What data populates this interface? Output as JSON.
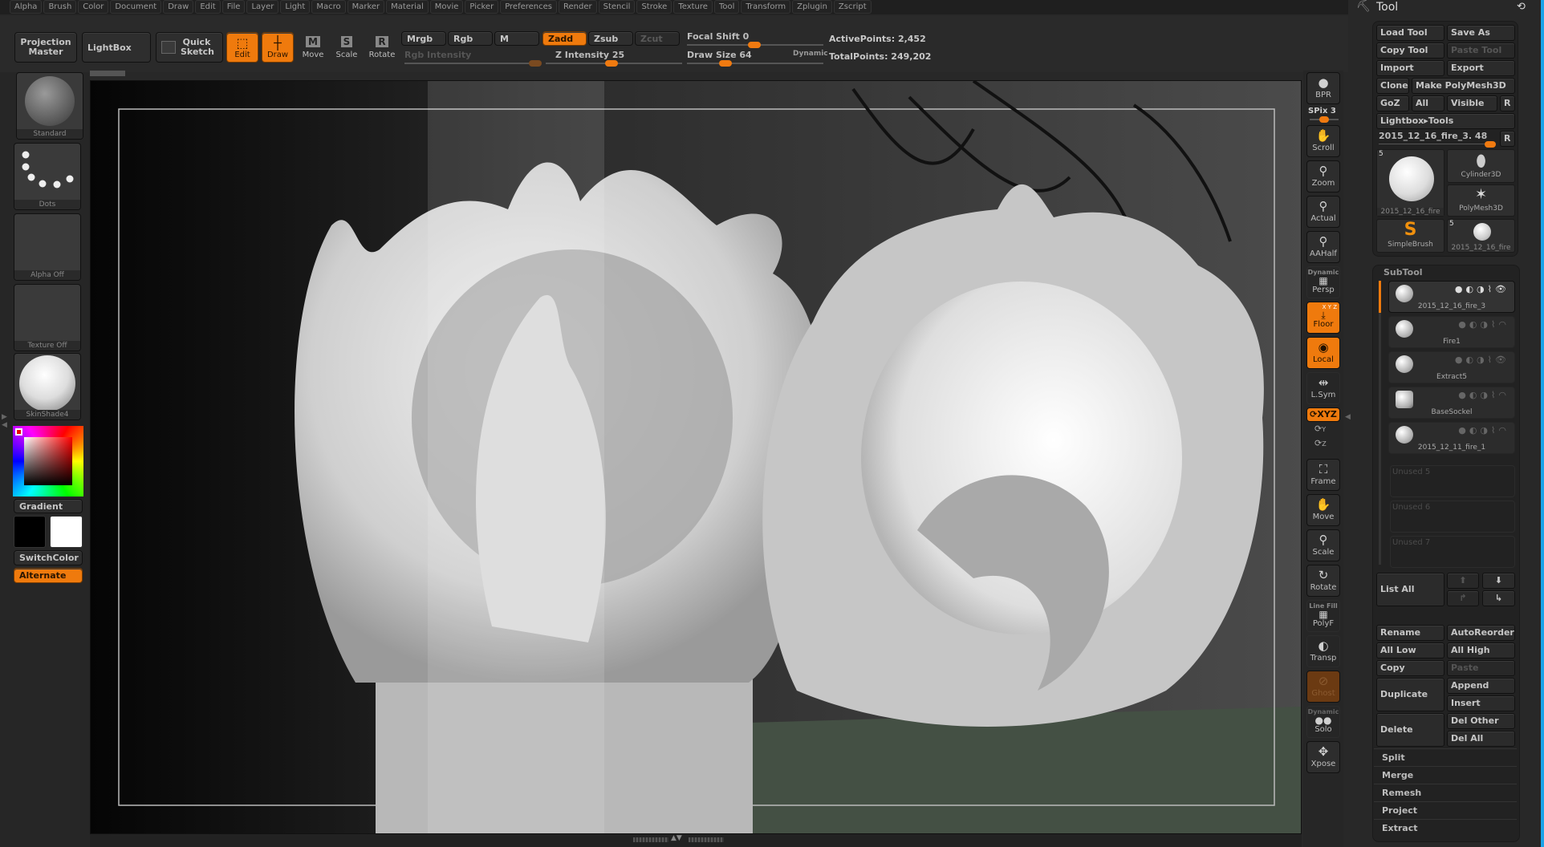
{
  "menubar": [
    "Alpha",
    "Brush",
    "Color",
    "Document",
    "Draw",
    "Edit",
    "File",
    "Layer",
    "Light",
    "Macro",
    "Marker",
    "Material",
    "Movie",
    "Picker",
    "Preferences",
    "Render",
    "Stencil",
    "Stroke",
    "Texture",
    "Tool",
    "Transform",
    "Zplugin",
    "Zscript"
  ],
  "toolbar": {
    "projection_master": "Projection Master",
    "lightbox": "LightBox",
    "quick_sketch": "Quick Sketch",
    "edit": "Edit",
    "draw": "Draw",
    "move": "Move",
    "scale": "Scale",
    "rotate": "Rotate",
    "move_key": "M",
    "scale_key": "S",
    "rotate_key": "R",
    "mrgb": "Mrgb",
    "rgb": "Rgb",
    "m": "M",
    "zadd": "Zadd",
    "zsub": "Zsub",
    "zcut": "Zcut",
    "rgb_intensity_label": "Rgb Intensity",
    "z_intensity_label": "Z Intensity",
    "z_intensity_value": "25",
    "focal_shift_label": "Focal Shift",
    "focal_shift_value": "0",
    "draw_size_label": "Draw Size",
    "draw_size_value": "64",
    "dynamic": "Dynamic",
    "active_points": "ActivePoints: 2,452",
    "total_points": "TotalPoints: 249,202"
  },
  "left_shelf": {
    "brush": "Standard",
    "stroke": "Dots",
    "alpha": "Alpha Off",
    "texture": "Texture Off",
    "material": "SkinShade4",
    "gradient": "Gradient",
    "switch_color": "SwitchColor",
    "alternate": "Alternate",
    "primary_color": "#000000",
    "secondary_color": "#ffffff",
    "picked_hue": "#ff0000"
  },
  "right_toolbar": {
    "bpr": "BPR",
    "spix": "SPix 3",
    "scroll": "Scroll",
    "zoom": "Zoom",
    "actual": "Actual",
    "aahalf": "AAHalf",
    "dynamic": "Dynamic",
    "persp": "Persp",
    "xyz_small": "X Y Z",
    "floor": "Floor",
    "local": "Local",
    "lsym": "L.Sym",
    "xyz": "XYZ",
    "y": "Y",
    "z": "Z",
    "frame": "Frame",
    "move": "Move",
    "scale": "Scale",
    "rotate": "Rotate",
    "line_fill": "Line Fill",
    "polyf": "PolyF",
    "transp": "Transp",
    "ghost": "Ghost",
    "solo_dynamic": "Dynamic",
    "solo": "Solo",
    "xpose": "Xpose"
  },
  "tool_panel": {
    "title": "Tool",
    "load_tool": "Load Tool",
    "save_as": "Save As",
    "copy_tool": "Copy Tool",
    "paste_tool": "Paste Tool",
    "import": "Import",
    "export": "Export",
    "clone": "Clone",
    "make_polymesh": "Make PolyMesh3D",
    "goz": "GoZ",
    "all": "All",
    "visible": "Visible",
    "r": "R",
    "lightbox_tools": "Lightbox▸Tools",
    "current_tool": "2015_12_16_fire_3. 48",
    "tools": [
      {
        "name": "2015_12_16_fire",
        "count": "5"
      },
      {
        "name": "Cylinder3D"
      },
      {
        "name": "PolyMesh3D"
      },
      {
        "name": "SimpleBrush"
      },
      {
        "name": "2015_12_16_fire",
        "count": "5"
      }
    ]
  },
  "subtool": {
    "title": "SubTool",
    "items": [
      {
        "name": "2015_12_16_fire_3",
        "selected": true,
        "visible": true
      },
      {
        "name": "Fire1",
        "visible": false
      },
      {
        "name": "Extract5",
        "visible": true
      },
      {
        "name": "BaseSockel",
        "visible": false
      },
      {
        "name": "2015_12_11_fire_1",
        "visible": false
      }
    ],
    "unused": [
      "Unused 5",
      "Unused 6",
      "Unused 7"
    ],
    "list_all": "List All",
    "rename": "Rename",
    "auto_reorder": "AutoReorder",
    "all_low": "All Low",
    "all_high": "All High",
    "copy": "Copy",
    "paste": "Paste",
    "duplicate": "Duplicate",
    "append": "Append",
    "insert": "Insert",
    "delete": "Delete",
    "del_other": "Del Other",
    "del_all": "Del All",
    "sections": [
      "Split",
      "Merge",
      "Remesh",
      "Project",
      "Extract"
    ]
  }
}
